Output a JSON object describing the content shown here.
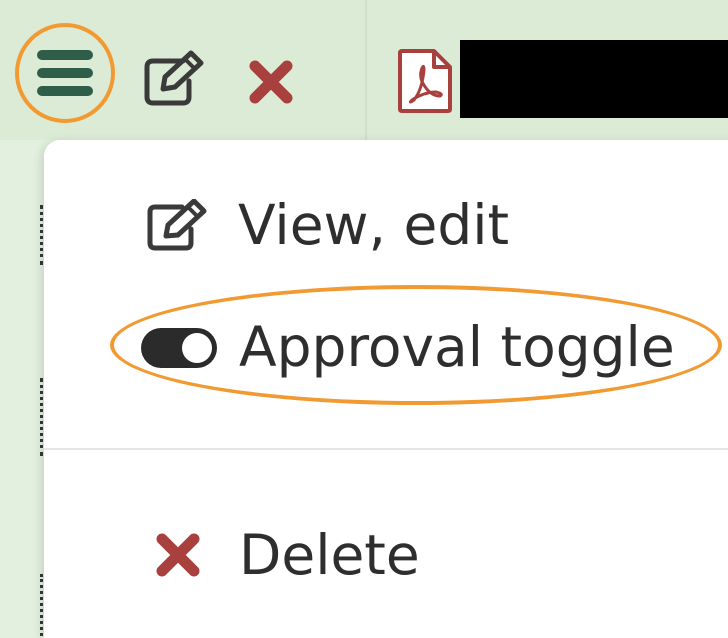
{
  "toolbar": {
    "icons": {
      "menu": "hamburger-icon",
      "edit": "edit-icon",
      "delete": "close-icon",
      "pdf": "pdf-file-icon"
    }
  },
  "menu": {
    "items": [
      {
        "label": "View, edit",
        "icon": "edit-icon"
      },
      {
        "label": "Approval toggle",
        "icon": "toggle-icon"
      },
      {
        "label": "Delete",
        "icon": "close-icon"
      }
    ]
  },
  "colors": {
    "toolbar_bg": "#dcebd6",
    "hamburger": "#2e5e49",
    "highlight": "#f29a32",
    "delete_red": "#a8403e",
    "icon_dark": "#3a3a3a"
  }
}
